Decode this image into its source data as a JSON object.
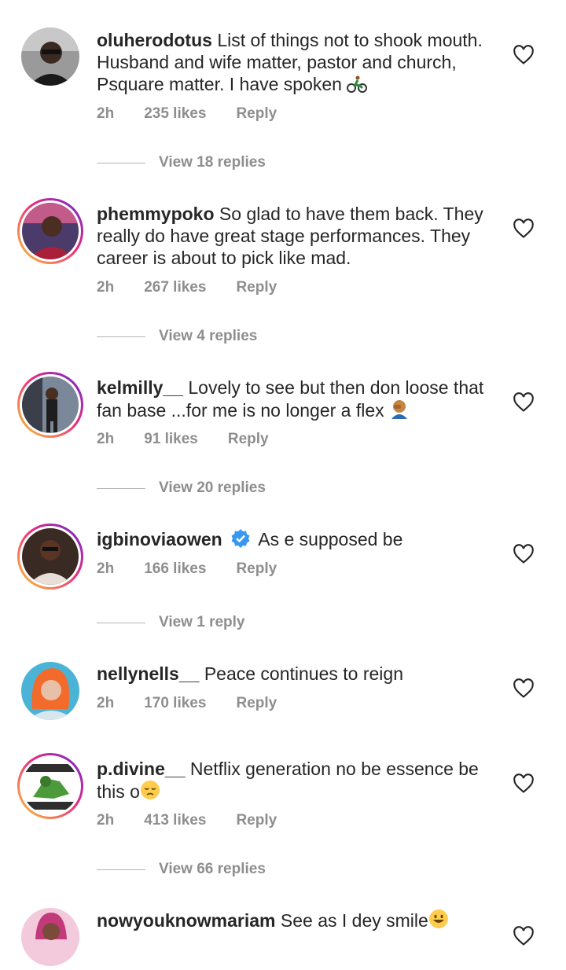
{
  "comments": [
    {
      "username": "oluherodotus",
      "text": "List of things not to shook mouth. Husband and wife matter, pastor and church, Psquare matter. I have spoken",
      "time": "2h",
      "likes": "235 likes",
      "reply": "Reply",
      "view_replies": "View 18 replies"
    },
    {
      "username": "phemmypoko",
      "text": "So glad to have them back. They really do have great stage performances. They career is about to pick like mad.",
      "time": "2h",
      "likes": "267 likes",
      "reply": "Reply",
      "view_replies": "View 4 replies"
    },
    {
      "username": "kelmilly__",
      "text": "Lovely to see but then don loose that fan base ...for me is no longer a flex",
      "time": "2h",
      "likes": "91 likes",
      "reply": "Reply",
      "view_replies": "View 20 replies"
    },
    {
      "username": "igbinoviaowen",
      "text": "As e supposed be",
      "time": "2h",
      "likes": "166 likes",
      "reply": "Reply",
      "view_replies": "View 1 reply"
    },
    {
      "username": "nellynells__",
      "text": "Peace continues to reign",
      "time": "2h",
      "likes": "170 likes",
      "reply": "Reply"
    },
    {
      "username": "p.divine__",
      "text": "Netflix generation no be essence be this o",
      "time": "2h",
      "likes": "413 likes",
      "reply": "Reply",
      "view_replies": "View 66 replies"
    },
    {
      "username": "nowyouknowmariam",
      "text": "See as I dey smile"
    }
  ],
  "icons": {
    "like": "heart-outline-icon",
    "verified": "verified-badge-icon",
    "verified_color": "#3897f0"
  }
}
